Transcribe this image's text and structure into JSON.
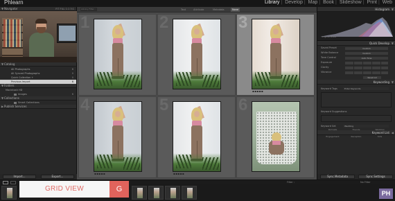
{
  "app": {
    "brand": "Phlearn"
  },
  "modules": [
    "Library",
    "Develop",
    "Map",
    "Book",
    "Slideshow",
    "Print",
    "Web"
  ],
  "left_panel": {
    "navigator": {
      "title": "Navigator",
      "zooms": "FIT  FILL  1:1  3:1"
    },
    "catalog": {
      "title": "Catalog",
      "items": [
        {
          "label": "All Photographs",
          "count": "6"
        },
        {
          "label": "All Synced Photographs",
          "count": "0"
        },
        {
          "label": "Quick Collection +",
          "count": "0"
        },
        {
          "label": "Previous Import",
          "count": "6"
        }
      ]
    },
    "folders": {
      "title": "Folders",
      "drive": "Macintosh HD",
      "folder": "Images",
      "folder_count": "6"
    },
    "collections": {
      "title": "Collections",
      "item": "Smart Collections"
    },
    "publish": {
      "title": "Publish Services"
    },
    "import_label": "Import...",
    "export_label": "Export..."
  },
  "filter_bar": {
    "field_label": "Library Filter :",
    "options": [
      "Text",
      "Attribute",
      "Metadata",
      "None"
    ]
  },
  "grid": {
    "cells": [
      {
        "num": "1",
        "style": "dim",
        "selected": false
      },
      {
        "num": "2",
        "style": "bright",
        "selected": false
      },
      {
        "num": "3",
        "style": "warm",
        "selected": true
      },
      {
        "num": "4",
        "style": "dim",
        "selected": false
      },
      {
        "num": "5",
        "style": "bright",
        "selected": false
      },
      {
        "num": "6",
        "style": "outdoor",
        "selected": false
      }
    ],
    "rating_dots": "▪▪▪▪▪"
  },
  "right_panel": {
    "histogram_title": "Histogram",
    "original_photo": "Original Photo",
    "quick_develop": {
      "title": "Quick Develop",
      "rows": [
        {
          "label": "Saved Preset",
          "value": "Custom"
        },
        {
          "label": "White Balance",
          "value": "Custom"
        },
        {
          "label": "Tone Control",
          "value": "Auto Tone"
        },
        {
          "label": "Exposure",
          "value": ""
        },
        {
          "label": "Clarity",
          "value": ""
        },
        {
          "label": "Vibrance",
          "value": ""
        }
      ],
      "reset": "Reset All"
    },
    "keywording": {
      "title": "Keywording",
      "tags_label": "Keyword Tags",
      "tags_value": "Enter Keywords",
      "suggestions_label": "Keyword Suggestions",
      "set_label": "Keyword Set",
      "set_value": "Wedding",
      "set_items": [
        "Portraits",
        "Friends",
        "Wedding",
        "Candid",
        "Family",
        "Detail",
        "Engagement",
        "Reception",
        "Kids"
      ]
    },
    "keyword_list": {
      "title": "Keyword List"
    },
    "sync_metadata": "Sync Metadata",
    "sync_settings": "Sync Settings"
  },
  "toolbar": {
    "filter_label": "Filter :",
    "filter_value": "No Filter"
  },
  "overlay": {
    "title": "GRID VIEW",
    "shortcut": "G"
  },
  "logo": "PH",
  "colors": {
    "accent": "#e0635c",
    "banner_text": "#e06b66",
    "logo": "#7a6a9e"
  }
}
